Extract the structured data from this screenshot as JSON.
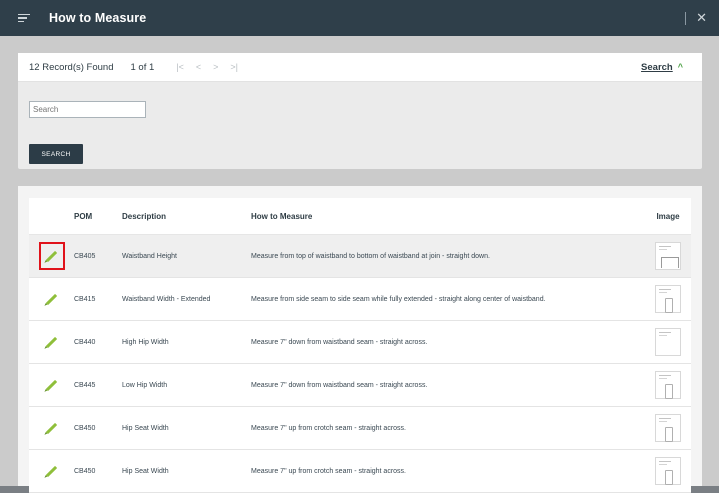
{
  "header": {
    "title": "How to Measure"
  },
  "toolbar": {
    "records": "12 Record(s) Found",
    "pages": "1 of 1",
    "search_toggle": "Search"
  },
  "search": {
    "placeholder": "Search",
    "button": "SEARCH"
  },
  "table": {
    "columns": [
      "POM",
      "Description",
      "How to Measure",
      "Image"
    ],
    "rows": [
      {
        "pom": "CB405",
        "description": "Waistband Height",
        "how": "Measure from top of waistband to bottom of waistband at join - straight down."
      },
      {
        "pom": "CB415",
        "description": "Waistband Width - Extended",
        "how": "Measure from side seam to side seam while fully extended - straight along center of waistband."
      },
      {
        "pom": "CB440",
        "description": "High Hip Width",
        "how": "Measure 7\" down from waistband seam - straight across."
      },
      {
        "pom": "CB445",
        "description": "Low Hip Width",
        "how": "Measure 7\" down from waistband seam - straight across."
      },
      {
        "pom": "CB450",
        "description": "Hip Seat Width",
        "how": "Measure 7\" up from crotch seam - straight across."
      },
      {
        "pom": "CB450",
        "description": "Hip Seat Width",
        "how": "Measure 7\" up from crotch seam - straight across."
      }
    ]
  },
  "colors": {
    "header": "#2f3f4a",
    "accent": "#8fbf3a",
    "highlight": "#e0121a",
    "button": "#2c3c47"
  },
  "icons": {
    "menu": "menu-icon",
    "close": "close-icon",
    "edit": "pencil-icon",
    "expand": "chevron-up-icon"
  }
}
